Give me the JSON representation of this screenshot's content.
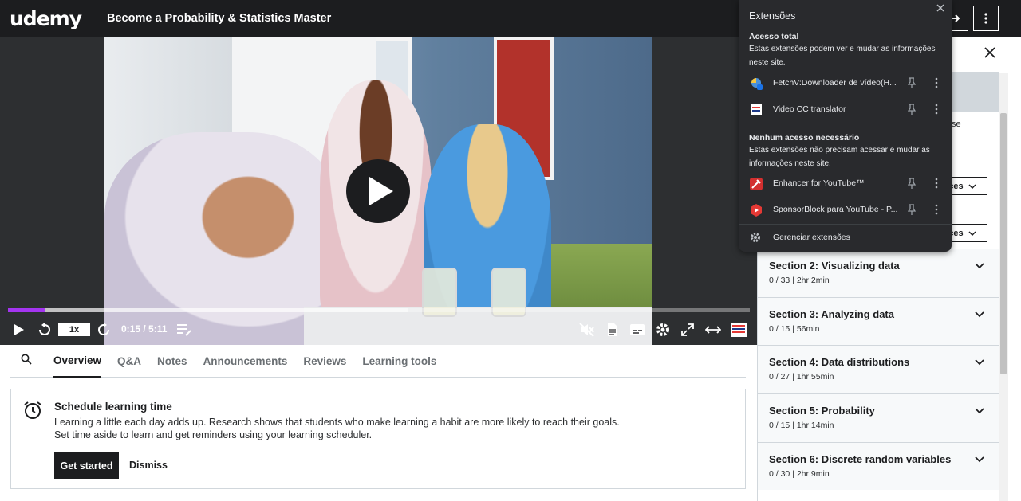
{
  "header": {
    "logo": "udemy",
    "course_title": "Become a Probability & Statistics Master"
  },
  "player": {
    "speed": "1x",
    "time": "0:15 / 5:11",
    "progress_played": 0.05,
    "progress_buffered": 0.54
  },
  "tabs": [
    {
      "label": "Overview",
      "active": true
    },
    {
      "label": "Q&A"
    },
    {
      "label": "Notes"
    },
    {
      "label": "Announcements"
    },
    {
      "label": "Reviews"
    },
    {
      "label": "Learning tools"
    }
  ],
  "schedule": {
    "title": "Schedule learning time",
    "line1": "Learning a little each day adds up. Research shows that students who make learning a habit are more likely to reach their goals.",
    "line2": "Set time aside to learn and get reminders using your learning scheduler.",
    "primary": "Get started",
    "secondary": "Dismiss"
  },
  "sidebar": {
    "behind_text": "se",
    "resources_label": "rces",
    "sections": [
      {
        "title": "Section 2: Visualizing data",
        "meta": "0 / 33 | 2hr 2min"
      },
      {
        "title": "Section 3: Analyzing data",
        "meta": "0 / 15 | 56min"
      },
      {
        "title": "Section 4: Data distributions",
        "meta": "0 / 27 | 1hr 55min"
      },
      {
        "title": "Section 5: Probability",
        "meta": "0 / 15 | 1hr 14min"
      },
      {
        "title": "Section 6: Discrete random variables",
        "meta": "0 / 30 | 2hr 9min"
      }
    ]
  },
  "extensions": {
    "title": "Extensões",
    "full_access_heading": "Acesso total",
    "full_access_desc": "Estas extensões podem ver e mudar as informações neste site.",
    "full_access_items": [
      {
        "name": "FetchV:Downloader de vídeo(H...",
        "icon": "fetchv-icon"
      },
      {
        "name": "Video CC translator",
        "icon": "video-cc-icon"
      }
    ],
    "no_access_heading": "Nenhum acesso necessário",
    "no_access_desc": "Estas extensões não precisam acessar e mudar as informações neste site.",
    "no_access_items": [
      {
        "name": "Enhancer for YouTube™",
        "icon": "enhancer-icon"
      },
      {
        "name": "SponsorBlock para YouTube - P...",
        "icon": "sponsorblock-icon"
      }
    ],
    "manage": "Gerenciar extensões"
  }
}
